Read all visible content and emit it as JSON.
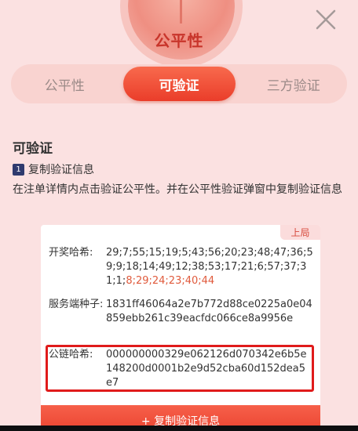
{
  "header": {
    "title": "公平性"
  },
  "tabs": [
    {
      "label": "公平性"
    },
    {
      "label": "可验证"
    },
    {
      "label": "三方验证"
    }
  ],
  "section": {
    "title": "可验证",
    "step_num": "1",
    "step_label": "复制验证信息",
    "description": "在注单详情内点击验证公平性。并在公平性验证弹窗中复制验证信息"
  },
  "card": {
    "badge": "上局",
    "rows": [
      {
        "label": "开奖哈希:",
        "value_main": "29;7;55;15;19;5;43;56;20;23;48;47;36;59;9;18;14;49;12;38;53;17;21;6;57;37;31;1;",
        "value_highlight": "8;29;24;23;40;44"
      },
      {
        "label": "服务端种子:",
        "value": "1831ff46064a2e7b772d88ce0225a0e04859ebb261c39eacfdc066ce8a9956e"
      },
      {
        "label": "公链哈希:",
        "value": "000000000329e062126d070342e6b5e148200d0001b2e9d52cba60d152dea5e7"
      }
    ],
    "copy_button": "+ 复制验证信息"
  },
  "colors": {
    "accent": "#ea3d2a",
    "background": "#fbe1e1",
    "highlight_border": "#e01b1b"
  }
}
